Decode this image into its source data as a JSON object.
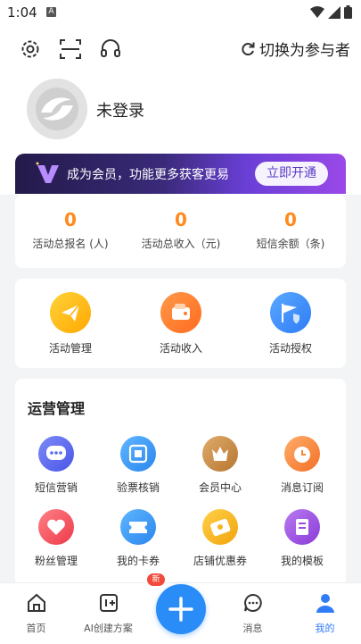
{
  "status_bar": {
    "time": "1:04",
    "notification_letter": "A"
  },
  "topbar": {
    "switch_role_label": "切换为参与者"
  },
  "profile": {
    "login_status": "未登录"
  },
  "vip_banner": {
    "text": "成为会员，功能更多获客更易",
    "button_label": "立即开通"
  },
  "stats": [
    {
      "value": "0",
      "label": "活动总报名 (人)"
    },
    {
      "value": "0",
      "label": "活动总收入（元)"
    },
    {
      "value": "0",
      "label": "短信余额（条)"
    }
  ],
  "actions": [
    {
      "label": "活动管理",
      "icon": "paper-plane-icon",
      "color": "#ffbb12"
    },
    {
      "label": "活动收入",
      "icon": "wallet-icon",
      "color": "#ff7a2a"
    },
    {
      "label": "活动授权",
      "icon": "flag-shield-icon",
      "color": "#3a8ff5"
    }
  ],
  "operations": {
    "title": "运营管理",
    "items": [
      {
        "label": "短信营销",
        "icon": "chat-bubble-icon",
        "color": "#5b6cf0"
      },
      {
        "label": "验票核销",
        "icon": "scan-icon",
        "color": "#2f9bf0"
      },
      {
        "label": "会员中心",
        "icon": "crown-icon",
        "color": "#c9853b"
      },
      {
        "label": "消息订阅",
        "icon": "clock-icon",
        "color": "#f5893a"
      },
      {
        "label": "粉丝管理",
        "icon": "heart-icon",
        "color": "#f2555f"
      },
      {
        "label": "我的卡券",
        "icon": "ticket-icon",
        "color": "#2f9bf0"
      },
      {
        "label": "店铺优惠券",
        "icon": "coupon-icon",
        "color": "#f5b51c"
      },
      {
        "label": "我的模板",
        "icon": "template-icon",
        "color": "#9a4ce0"
      }
    ]
  },
  "tabbar": {
    "items": [
      {
        "label": "首页",
        "icon": "home-icon"
      },
      {
        "label": "AI创建方案",
        "icon": "ai-create-icon"
      },
      {
        "label": "消息",
        "icon": "message-icon"
      },
      {
        "label": "我的",
        "icon": "person-icon"
      }
    ],
    "badge": "新"
  },
  "colors": {
    "accent": "#2f7cf6",
    "stat_value": "#ff8a1e"
  }
}
